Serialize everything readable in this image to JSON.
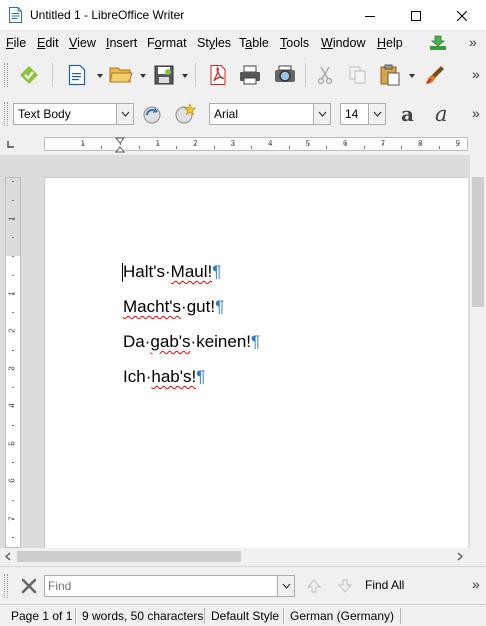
{
  "window": {
    "title": "Untitled 1 - LibreOffice Writer",
    "minimize_glyph": "minimize",
    "maximize_glyph": "maximize",
    "close_glyph": "close"
  },
  "menu": {
    "items": [
      {
        "label": "File",
        "accel": "F"
      },
      {
        "label": "Edit",
        "accel": "E"
      },
      {
        "label": "View",
        "accel": "V"
      },
      {
        "label": "Insert",
        "accel": "I"
      },
      {
        "label": "Format",
        "accel": "o"
      },
      {
        "label": "Styles",
        "accel": "y"
      },
      {
        "label": "Table",
        "accel": "a"
      },
      {
        "label": "Tools",
        "accel": "T"
      },
      {
        "label": "Window",
        "accel": "W"
      },
      {
        "label": "Help",
        "accel": "H"
      }
    ],
    "overflow": "»"
  },
  "toolbar": {
    "overflow": "»",
    "paragraph_style": "Text Body",
    "font_name": "Arial",
    "font_size": "14"
  },
  "ruler": {
    "h_numbers": [
      "1",
      "1",
      "2",
      "3",
      "4",
      "5",
      "6",
      "7",
      "8",
      "9"
    ],
    "v_numbers": [
      "1",
      "1",
      "2",
      "3",
      "4",
      "5",
      "6",
      "7"
    ]
  },
  "document": {
    "lines": [
      {
        "words": [
          "Halt's",
          "Maul!"
        ],
        "pilcrow": "¶"
      },
      {
        "words": [
          "Macht's",
          "gut!"
        ],
        "pilcrow": "¶"
      },
      {
        "words": [
          "Da",
          "gab's",
          "keinen!"
        ],
        "pilcrow": "¶"
      },
      {
        "words": [
          "Ich",
          "hab's!"
        ],
        "pilcrow": "¶"
      }
    ],
    "space_marker": "·"
  },
  "findbar": {
    "placeholder": "Find",
    "find_all": "Find All",
    "overflow": "»"
  },
  "status": {
    "page": "Page 1 of 1",
    "word_count": "9 words, 50 characters",
    "page_style": "Default Style",
    "language": "German (Germany)"
  }
}
